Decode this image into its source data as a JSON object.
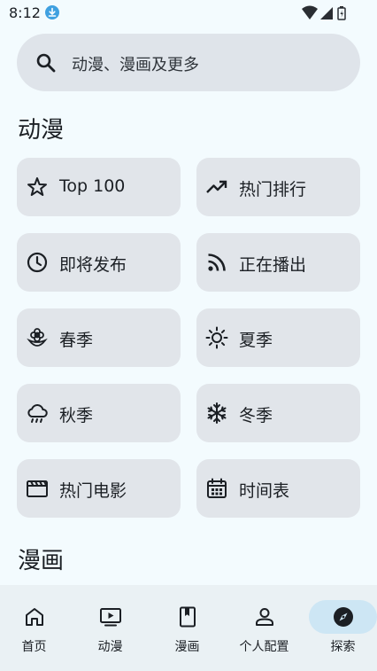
{
  "status_bar": {
    "time": "8:12",
    "icons": [
      "download-icon",
      "wifi-icon",
      "signal-icon",
      "battery-icon"
    ]
  },
  "search": {
    "placeholder": "动漫、漫画及更多",
    "icon": "search-icon"
  },
  "sections": {
    "anime_title": "动漫",
    "manga_title": "漫画"
  },
  "anime_tiles": [
    {
      "label": "Top 100",
      "icon": "star-icon"
    },
    {
      "label": "热门排行",
      "icon": "trending-up-icon"
    },
    {
      "label": "即将发布",
      "icon": "clock-icon"
    },
    {
      "label": "正在播出",
      "icon": "rss-icon"
    },
    {
      "label": "春季",
      "icon": "flower-icon"
    },
    {
      "label": "夏季",
      "icon": "sun-icon"
    },
    {
      "label": "秋季",
      "icon": "rain-cloud-icon"
    },
    {
      "label": "冬季",
      "icon": "snowflake-icon"
    },
    {
      "label": "热门电影",
      "icon": "movie-clapper-icon"
    },
    {
      "label": "时间表",
      "icon": "calendar-icon"
    }
  ],
  "bottom_nav": [
    {
      "label": "首页",
      "icon": "home-icon",
      "active": false
    },
    {
      "label": "动漫",
      "icon": "tv-play-icon",
      "active": false
    },
    {
      "label": "漫画",
      "icon": "book-icon",
      "active": false
    },
    {
      "label": "个人配置",
      "icon": "person-icon",
      "active": false
    },
    {
      "label": "探索",
      "icon": "compass-icon",
      "active": true
    }
  ],
  "colors": {
    "background": "#f3fbfe",
    "tile": "#e1e5ea",
    "search_bar": "#dfe4ea",
    "nav_bar": "#eaf1f4",
    "nav_active_pill": "#cde6f4",
    "download_badge": "#3fa0e0"
  }
}
